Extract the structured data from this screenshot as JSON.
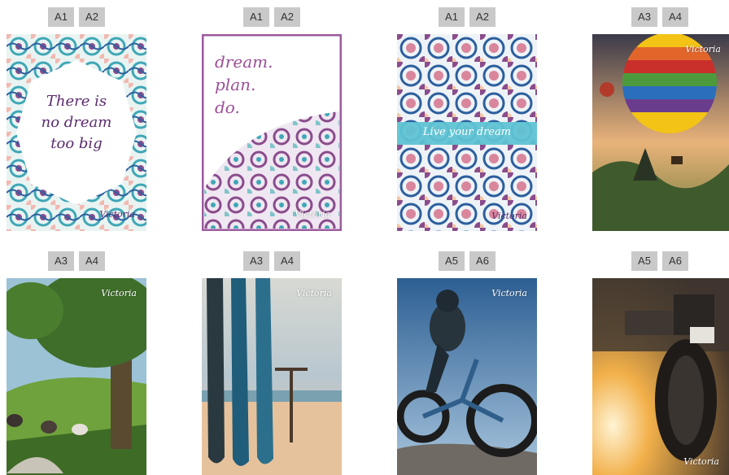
{
  "products": [
    {
      "sizes": [
        "A1",
        "A2"
      ],
      "text": "There is no dream too big",
      "brand": "Victoria"
    },
    {
      "sizes": [
        "A1",
        "A2"
      ],
      "text": "dream. plan. do.",
      "brand": "Victoria"
    },
    {
      "sizes": [
        "A1",
        "A2"
      ],
      "text": "Live your dream",
      "brand": "Victoria"
    },
    {
      "sizes": [
        "A3",
        "A4"
      ],
      "text": "",
      "brand": "Victoria"
    },
    {
      "sizes": [
        "A3",
        "A4"
      ],
      "text": "",
      "brand": "Victoria"
    },
    {
      "sizes": [
        "A3",
        "A4"
      ],
      "text": "",
      "brand": "Victoria"
    },
    {
      "sizes": [
        "A5",
        "A6"
      ],
      "text": "",
      "brand": "Victoria"
    },
    {
      "sizes": [
        "A5",
        "A6"
      ],
      "text": "",
      "brand": "Victoria"
    }
  ]
}
